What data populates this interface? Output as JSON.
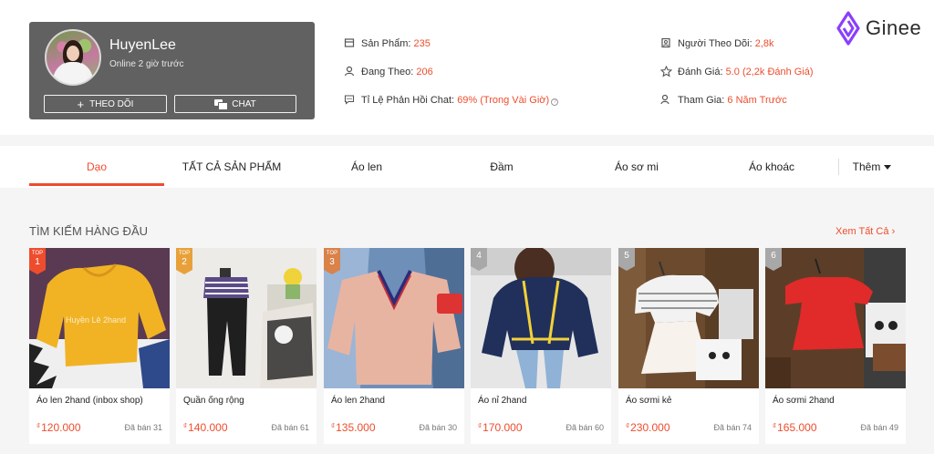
{
  "shop": {
    "name": "HuyenLee",
    "online_status": "Online 2 giờ trước",
    "follow_label": "THEO DÕI",
    "chat_label": "CHAT"
  },
  "stats": {
    "products_label": "Sản Phẩm:",
    "products_value": "235",
    "following_label": "Đang Theo:",
    "following_value": "206",
    "chat_response_label": "Tỉ Lệ Phản Hồi Chat:",
    "chat_response_value": "69% (Trong Vài Giờ)",
    "followers_label": "Người Theo Dõi:",
    "followers_value": "2,8k",
    "rating_label": "Đánh Giá:",
    "rating_value": "5.0 (2,2k Đánh Giá)",
    "joined_label": "Tham Gia:",
    "joined_value": "6 Năm Trước"
  },
  "logo": {
    "text": "Ginee"
  },
  "tabs": [
    {
      "label": "Dạo",
      "active": true
    },
    {
      "label": "TẤT CẢ SẢN PHẨM"
    },
    {
      "label": "Áo len"
    },
    {
      "label": "Đầm"
    },
    {
      "label": "Áo sơ mi"
    },
    {
      "label": "Áo khoác"
    },
    {
      "label": "Thêm"
    }
  ],
  "section": {
    "title": "TÌM KIẾM HÀNG ĐẦU",
    "see_all": "Xem Tất Cả"
  },
  "products": [
    {
      "rank_top": "TOP",
      "rank": "1",
      "name": "Áo len 2hand (inbox shop)",
      "currency": "₫",
      "price": "120.000",
      "sold": "Đã bán 31",
      "watermark": "Huyền Lê 2hand"
    },
    {
      "rank_top": "TOP",
      "rank": "2",
      "name": "Quần ống rộng",
      "currency": "₫",
      "price": "140.000",
      "sold": "Đã bán 61"
    },
    {
      "rank_top": "TOP",
      "rank": "3",
      "name": "Áo len 2hand",
      "currency": "₫",
      "price": "135.000",
      "sold": "Đã bán 30"
    },
    {
      "rank": "4",
      "name": "Áo nỉ 2hand",
      "currency": "₫",
      "price": "170.000",
      "sold": "Đã bán 60"
    },
    {
      "rank": "5",
      "name": "Áo sơmi kẻ",
      "currency": "₫",
      "price": "230.000",
      "sold": "Đã bán 74"
    },
    {
      "rank": "6",
      "name": "Áo sơmi 2hand",
      "currency": "₫",
      "price": "165.000",
      "sold": "Đã bán 49"
    }
  ],
  "colors": {
    "accent": "#ee4d2d",
    "card_bg": "#616161",
    "top_badge_1": "#ee4d2d",
    "top_badge_2": "#e8a13a",
    "top_badge_3": "#d9824a",
    "logo_purple": "#8a3ffc"
  }
}
